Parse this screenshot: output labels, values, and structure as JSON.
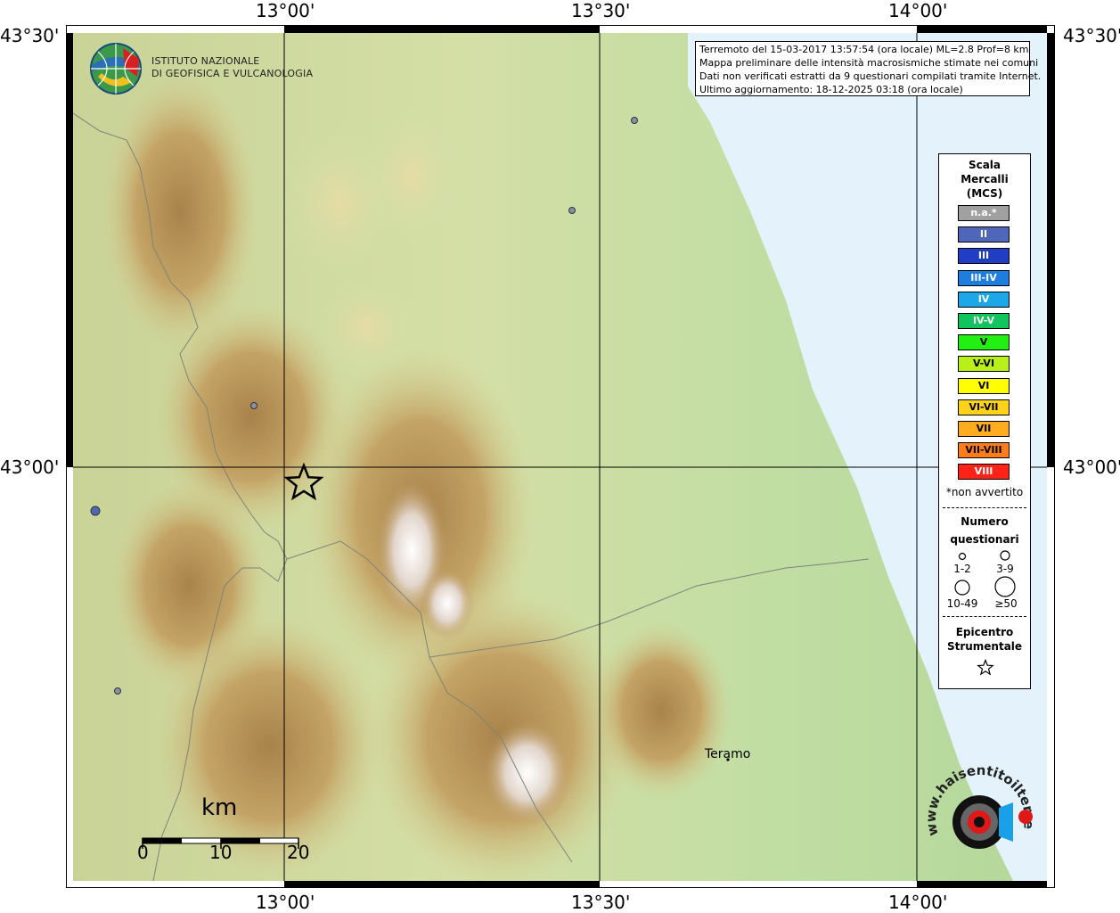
{
  "map": {
    "axis_labels": {
      "lon": [
        "13°00'",
        "13°30'",
        "14°00'"
      ],
      "lat": [
        "43°30'",
        "43°00'"
      ]
    },
    "info_box": {
      "line1": "Terremoto del 15-03-2017 13:57:54 (ora locale) ML=2.8 Prof=8 km",
      "line2": "Mappa preliminare delle intensità macrosismiche stimate nei comuni",
      "line3": "Dati non verificati estratti da 9 questionari compilati tramite Internet.",
      "line4": "Ultimo aggiornamento: 18-12-2025 03:18 (ora locale)"
    },
    "institute": {
      "line1": "ISTITUTO NAZIONALE",
      "line2": "DI GEOFISICA E VULCANOLOGIA"
    },
    "city": "Teramo",
    "scale_bar": {
      "unit": "km",
      "labels": [
        "0",
        "10",
        "20"
      ]
    },
    "watermark": {
      "text": "www.haisentitoilterremoto.it"
    }
  },
  "legend": {
    "title_line1": "Scala",
    "title_line2": "Mercalli",
    "title_line3": "(MCS)",
    "classes": [
      {
        "label": "n.a.*",
        "color": "#a0a0a0"
      },
      {
        "label": "II",
        "color": "#4f67b8"
      },
      {
        "label": "III",
        "color": "#1f3ec4"
      },
      {
        "label": "III-IV",
        "color": "#1e7ee0"
      },
      {
        "label": "IV",
        "color": "#1ba7e8"
      },
      {
        "label": "IV-V",
        "color": "#12c45e"
      },
      {
        "label": "V",
        "color": "#22f012"
      },
      {
        "label": "V-VI",
        "color": "#b9f01a"
      },
      {
        "label": "VI",
        "color": "#ffff00"
      },
      {
        "label": "VI-VII",
        "color": "#ffd21a"
      },
      {
        "label": "VII",
        "color": "#ffad1f"
      },
      {
        "label": "VII-VIII",
        "color": "#ff7c1a"
      },
      {
        "label": "VIII",
        "color": "#ff2216"
      }
    ],
    "note": "*non avvertito",
    "questionnaires_title_line1": "Numero",
    "questionnaires_title_line2": "questionari",
    "questionnaire_sizes": [
      "1-2",
      "3-9",
      "10-49",
      "≥50"
    ],
    "epicenter_title_line1": "Epicentro",
    "epicenter_title_line2": "Strumentale"
  },
  "points": [
    {
      "name": "station-north-coast",
      "color": "#8a8fa8"
    },
    {
      "name": "station-north-inland",
      "color": "#8a8fa8"
    },
    {
      "name": "station-central-west",
      "color": "#8a8fa8"
    },
    {
      "name": "station-far-west",
      "color": "#4f67b8"
    },
    {
      "name": "station-south-west",
      "color": "#8a8fa8"
    }
  ],
  "colors": {
    "sea": "#e3f2fb",
    "lowland": "#cfe0a8",
    "hills": "#d8cc8a",
    "mountain": "#b9955a",
    "peaks": "#f2f0f2"
  }
}
